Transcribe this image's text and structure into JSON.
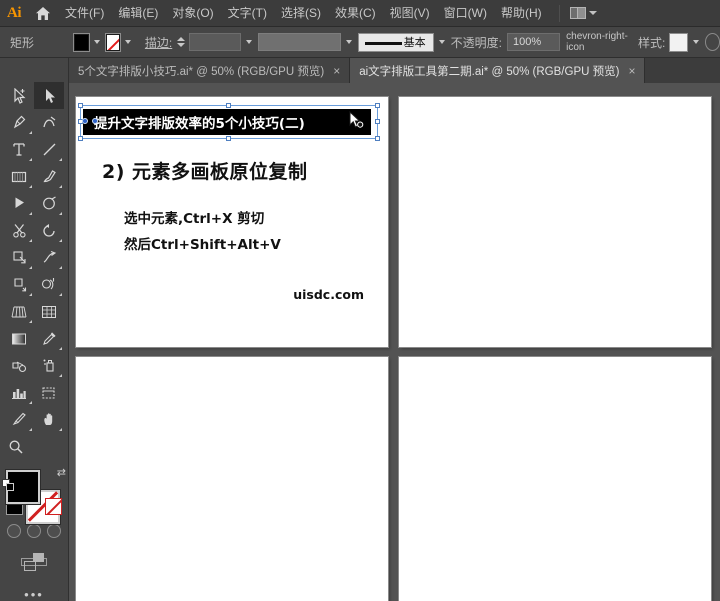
{
  "app": {
    "name": "Ai",
    "logo_text": "Ai",
    "home_icon": "home-icon"
  },
  "menubar": {
    "items": [
      {
        "label": "文件(F)",
        "name": "menu-file"
      },
      {
        "label": "编辑(E)",
        "name": "menu-edit"
      },
      {
        "label": "对象(O)",
        "name": "menu-object"
      },
      {
        "label": "文字(T)",
        "name": "menu-type"
      },
      {
        "label": "选择(S)",
        "name": "menu-select"
      },
      {
        "label": "效果(C)",
        "name": "menu-effect"
      },
      {
        "label": "视图(V)",
        "name": "menu-view"
      },
      {
        "label": "窗口(W)",
        "name": "menu-window"
      },
      {
        "label": "帮助(H)",
        "name": "menu-help"
      }
    ],
    "arrange_icon": "arrange-documents-icon",
    "arrange_caret": "chevron-down-icon"
  },
  "controlbar": {
    "object_type": "矩形",
    "fill_swatch": "fill-swatch-black",
    "fill_caret": "chevron-down-icon",
    "stroke_swatch": "stroke-swatch-none",
    "stroke_caret": "chevron-down-icon",
    "stroke_label": "描边:",
    "stroke_weight_value": "",
    "stroke_weight_caret": "chevron-down-icon",
    "variable_width_value": "",
    "profile_name": "基本",
    "profile_caret": "chevron-down-icon",
    "opacity_label": "不透明度:",
    "opacity_value": "100%",
    "opacity_arrow": "chevron-right-icon",
    "style_label": "样式:",
    "style_caret": "chevron-down-icon",
    "document_setup_icon": "document-setup-icon"
  },
  "tabs": [
    {
      "label": "5个文字排版小技巧.ai* @ 50% (RGB/GPU 预览)",
      "close": "×",
      "active": false,
      "name": "document-tab-1"
    },
    {
      "label": "ai文字排版工具第二期.ai* @ 50% (RGB/GPU 预览)",
      "close": "×",
      "active": true,
      "name": "document-tab-2"
    }
  ],
  "toolbar": {
    "tools": [
      {
        "name": "selection-tool",
        "icon": "selection-arrow-icon",
        "active": false
      },
      {
        "name": "direct-selection-tool",
        "icon": "direct-selection-arrow-icon",
        "active": true
      },
      {
        "name": "pen-tool",
        "icon": "pen-icon",
        "active": false
      },
      {
        "name": "curvature-tool",
        "icon": "curvature-icon",
        "active": false
      },
      {
        "name": "type-tool",
        "icon": "type-T-icon",
        "active": false
      },
      {
        "name": "line-segment-tool",
        "icon": "line-segment-icon",
        "active": false
      },
      {
        "name": "rectangle-tool",
        "icon": "rectangle-icon",
        "active": false
      },
      {
        "name": "paintbrush-tool",
        "icon": "paintbrush-icon",
        "active": false
      },
      {
        "name": "shaper-tool",
        "icon": "shaper-arrow-icon",
        "active": false
      },
      {
        "name": "pencil-eraser-tool",
        "icon": "eraser-icon",
        "active": false
      },
      {
        "name": "scissors-tool",
        "icon": "scissors-icon",
        "active": false
      },
      {
        "name": "rotate-tool",
        "icon": "rotate-icon",
        "active": false
      },
      {
        "name": "scale-tool",
        "icon": "scale-icon",
        "active": false
      },
      {
        "name": "width-warp-tool",
        "icon": "width-tool-icon",
        "active": false
      },
      {
        "name": "free-transform-tool",
        "icon": "free-transform-icon",
        "active": false
      },
      {
        "name": "shape-builder-tool",
        "icon": "shape-builder-icon",
        "active": false
      },
      {
        "name": "perspective-grid-tool",
        "icon": "perspective-grid-icon",
        "active": false
      },
      {
        "name": "mesh-tool",
        "icon": "mesh-grid-icon",
        "active": false
      },
      {
        "name": "gradient-tool",
        "icon": "gradient-icon",
        "active": false
      },
      {
        "name": "eyedropper-tool",
        "icon": "eyedropper-icon",
        "active": false
      },
      {
        "name": "blend-tool",
        "icon": "blend-icon",
        "active": false
      },
      {
        "name": "symbol-sprayer-tool",
        "icon": "symbol-sprayer-icon",
        "active": false
      },
      {
        "name": "column-graph-tool",
        "icon": "bar-chart-icon",
        "active": false
      },
      {
        "name": "artboard-tool",
        "icon": "artboard-icon",
        "active": false
      },
      {
        "name": "slice-tool",
        "icon": "slice-knife-icon",
        "active": false
      },
      {
        "name": "hand-tool",
        "icon": "hand-icon",
        "active": false
      },
      {
        "name": "zoom-tool",
        "icon": "magnifier-icon",
        "active": false
      }
    ],
    "fill_color": "#000000",
    "stroke_color": "#ffffff",
    "swap_icon": "swap-fill-stroke-icon",
    "default_icon": "default-fill-stroke-icon",
    "color_mode_color": "color-mode-icon",
    "color_mode_gradient": "gradient-mode-icon",
    "color_mode_none": "none-mode-icon",
    "draw_normal": "draw-normal-icon",
    "draw_behind": "draw-behind-icon",
    "draw_inside": "draw-inside-icon",
    "screen_mode": "change-screen-mode-icon",
    "more_tools": "•••"
  },
  "canvas": {
    "zoom": "50%",
    "artboards": [
      {
        "name": "artboard-1",
        "has_content": true
      },
      {
        "name": "artboard-2",
        "has_content": false
      },
      {
        "name": "artboard-3",
        "has_content": false
      },
      {
        "name": "artboard-4",
        "has_content": false
      }
    ],
    "slide": {
      "title": "提升文字排版效率的5个小技巧(二)",
      "heading": "2) 元素多画板原位复制",
      "line1": "选中元素,Ctrl+X 剪切",
      "line2": "然后Ctrl+Shift+Alt+V",
      "watermark": "uisdc.com"
    },
    "selection": {
      "visible": true,
      "handle_color": "#ffffff",
      "border_color": "#6a9ddb",
      "anchor_color": "#2e62c9",
      "cursor_icon": "selection-cursor-icon"
    }
  }
}
